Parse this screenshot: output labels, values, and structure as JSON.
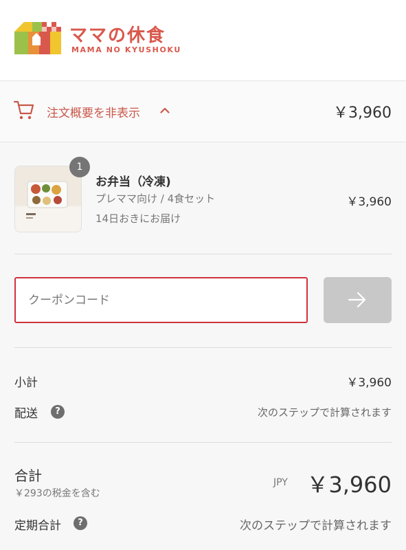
{
  "header": {
    "brand_name": "ママの休食",
    "brand_sub": "MAMA NO KYUSHOKU",
    "colors": {
      "brand": "#d9584c"
    }
  },
  "summary": {
    "toggle_label": "注文概要を非表示",
    "toggle_icon": "chevron-up-icon",
    "cart_icon": "cart-icon",
    "total": "￥3,960"
  },
  "item": {
    "quantity": "1",
    "name": "お弁当（冷凍)",
    "variant": "プレママ向け / 4食セット",
    "delivery": "14日おきにお届け",
    "price": "￥3,960"
  },
  "coupon": {
    "placeholder": "クーポンコード",
    "button_icon": "arrow-right-icon"
  },
  "costs": {
    "subtotal_label": "小計",
    "subtotal_value": "￥3,960",
    "shipping_label": "配送",
    "shipping_value": "次のステップで計算されます",
    "help_glyph": "?"
  },
  "total": {
    "label": "合計",
    "tax_note": "￥293の税金を含む",
    "currency": "JPY",
    "amount": "￥3,960",
    "recurring_label": "定期合計",
    "recurring_value": "次のステップで計算されます"
  }
}
